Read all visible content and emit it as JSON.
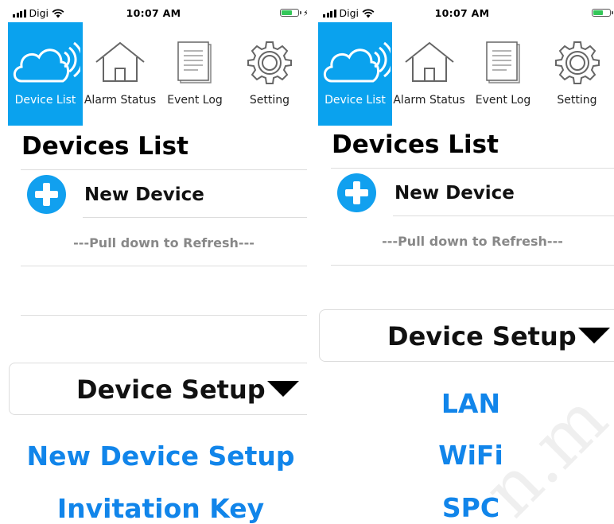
{
  "status": {
    "carrier": "Digi",
    "time": "10:07 AM"
  },
  "tabs": [
    {
      "label": "Device List",
      "icon": "cloud-wifi-icon"
    },
    {
      "label": "Alarm Status",
      "icon": "house-icon"
    },
    {
      "label": "Event Log",
      "icon": "document-icon"
    },
    {
      "label": "Setting",
      "icon": "gear-icon"
    }
  ],
  "page": {
    "title": "Devices List",
    "new_device": "New Device",
    "pull_hint": "---Pull down to Refresh---",
    "setup_label": "Device Setup"
  },
  "left_options": [
    "New Device Setup",
    "Invitation Key"
  ],
  "right_options": [
    "LAN",
    "WiFi",
    "SPC"
  ],
  "watermark": "n.m",
  "colors": {
    "accent": "#0aa2ee",
    "link": "#1185ea",
    "battery": "#34c759"
  }
}
